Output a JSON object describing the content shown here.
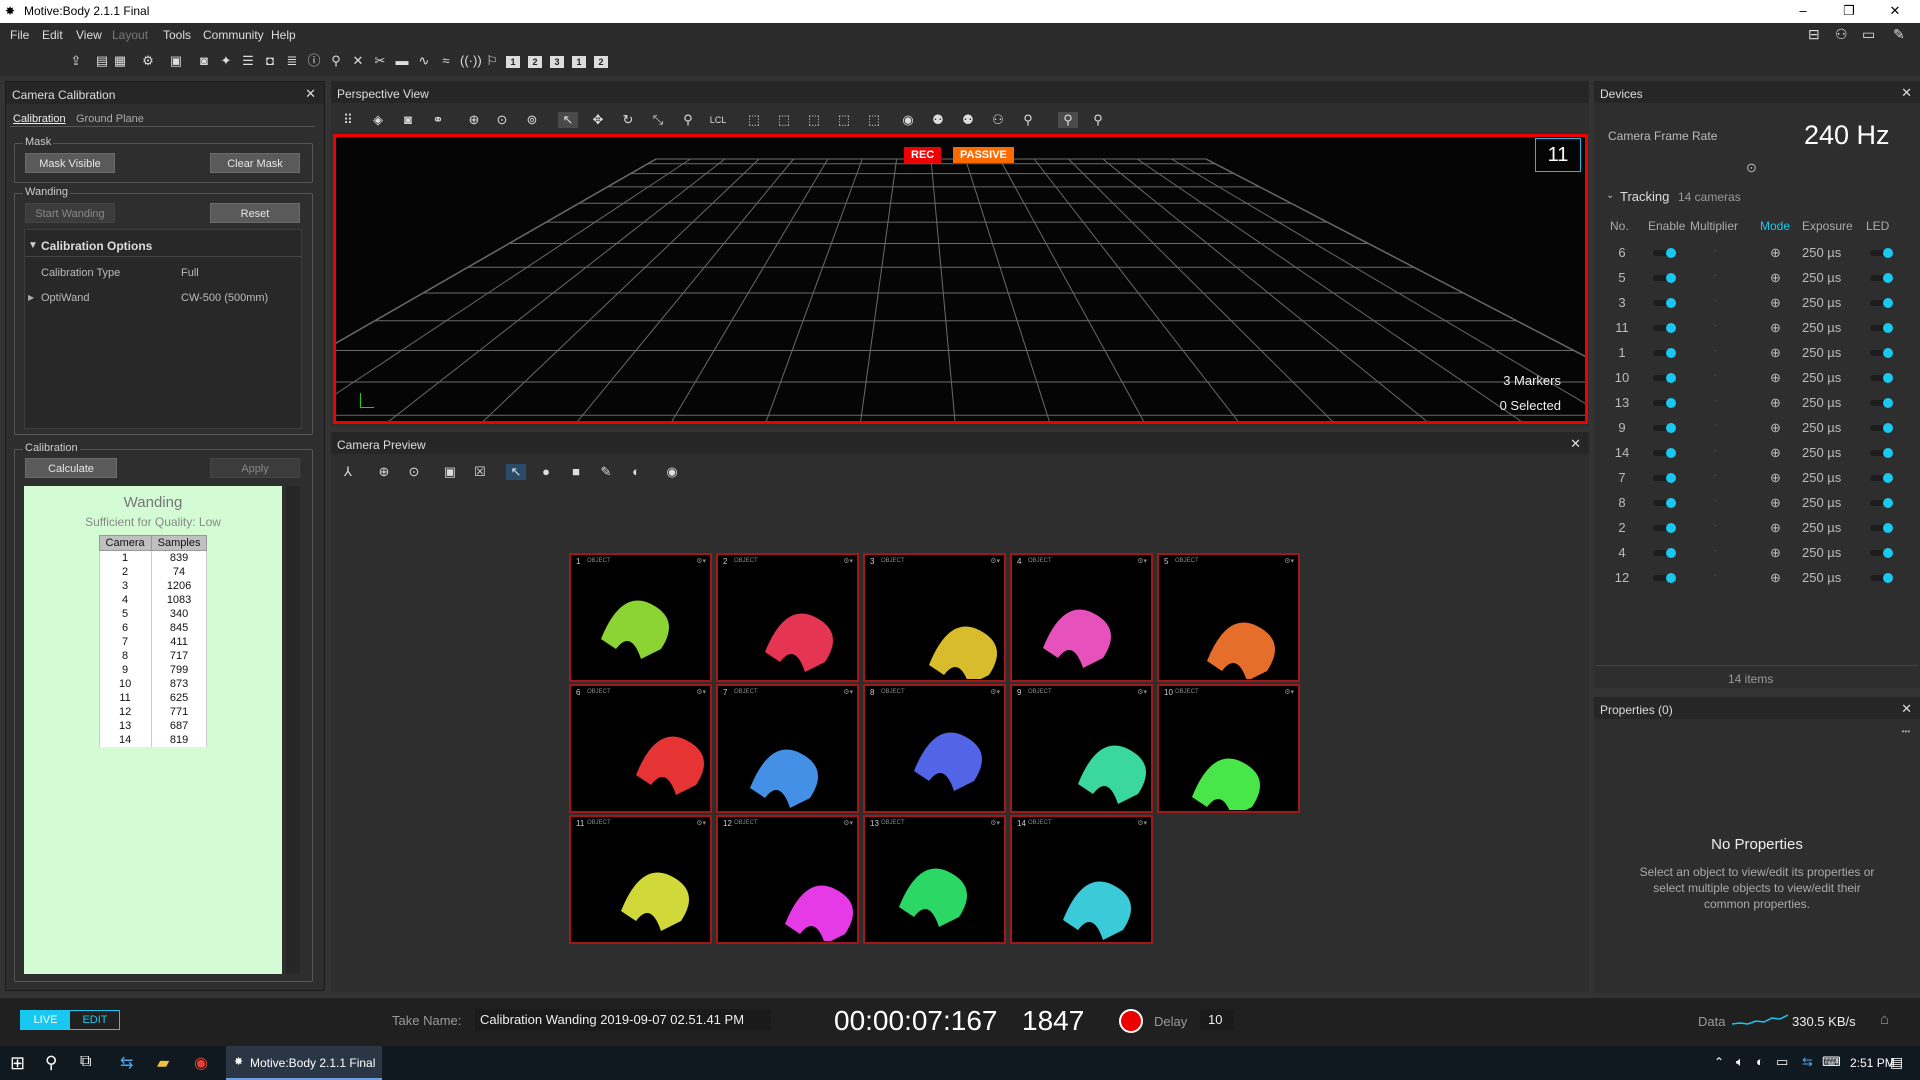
{
  "window": {
    "title": "Motive:Body 2.1.1 Final",
    "controls": [
      "–",
      "❐",
      "✕"
    ]
  },
  "menu": [
    "File",
    "Edit",
    "View",
    "Layout",
    "Tools",
    "Community",
    "Help"
  ],
  "toolbar": {
    "num_buttons": [
      "1",
      "2",
      "3",
      "1",
      "2"
    ]
  },
  "calib": {
    "title": "Camera Calibration",
    "tabs": [
      "Calibration",
      "Ground Plane"
    ],
    "mask": {
      "title": "Mask",
      "mask_visible": "Mask Visible",
      "clear_mask": "Clear Mask"
    },
    "wanding": {
      "title": "Wanding",
      "start": "Start Wanding",
      "reset": "Reset"
    },
    "options": {
      "title": "Calibration Options",
      "type_label": "Calibration Type",
      "type_value": "Full",
      "wand_label": "OptiWand",
      "wand_value": "CW-500 (500mm)"
    },
    "calibration": {
      "title": "Calibration",
      "calculate": "Calculate",
      "apply": "Apply"
    },
    "result": {
      "title": "Wanding",
      "quality": "Sufficient for Quality: Low",
      "col_camera": "Camera",
      "col_samples": "Samples",
      "rows": [
        [
          "1",
          "839"
        ],
        [
          "2",
          "74"
        ],
        [
          "3",
          "1206"
        ],
        [
          "4",
          "1083"
        ],
        [
          "5",
          "340"
        ],
        [
          "6",
          "845"
        ],
        [
          "7",
          "411"
        ],
        [
          "8",
          "717"
        ],
        [
          "9",
          "799"
        ],
        [
          "10",
          "873"
        ],
        [
          "11",
          "625"
        ],
        [
          "12",
          "771"
        ],
        [
          "13",
          "687"
        ],
        [
          "14",
          "819"
        ]
      ]
    }
  },
  "perspective": {
    "title": "Perspective View",
    "rec": "REC",
    "passive": "PASSIVE",
    "cube": "11",
    "markers": "3 Markers",
    "selected": "0 Selected",
    "tb_lcl": "LCL"
  },
  "preview": {
    "title": "Camera Preview",
    "tile_label": "OBJECT",
    "tiles": [
      {
        "n": "1",
        "color": "#9bea3a"
      },
      {
        "n": "2",
        "color": "#ff3b5c"
      },
      {
        "n": "3",
        "color": "#f0d030"
      },
      {
        "n": "4",
        "color": "#ff5ad0"
      },
      {
        "n": "5",
        "color": "#ff7a30"
      },
      {
        "n": "6",
        "color": "#ff3a3a"
      },
      {
        "n": "7",
        "color": "#4aa0ff"
      },
      {
        "n": "8",
        "color": "#5a70ff"
      },
      {
        "n": "9",
        "color": "#40f0b0"
      },
      {
        "n": "10",
        "color": "#50ff50"
      },
      {
        "n": "11",
        "color": "#e8f040"
      },
      {
        "n": "12",
        "color": "#ff40ff"
      },
      {
        "n": "13",
        "color": "#30f070"
      },
      {
        "n": "14",
        "color": "#40e0f0"
      }
    ]
  },
  "devices": {
    "title": "Devices",
    "frame_rate_label": "Camera Frame Rate",
    "frame_rate": "240 Hz",
    "tracking_label": "Tracking",
    "tracking_count": "14 cameras",
    "cols": [
      "No.",
      "Enable",
      "Multiplier",
      "Mode",
      "Exposure",
      "LED"
    ],
    "multiplier": "-",
    "cameras": [
      "6",
      "5",
      "3",
      "11",
      "1",
      "10",
      "13",
      "9",
      "14",
      "7",
      "8",
      "2",
      "4",
      "12"
    ],
    "exposure": "250 µs",
    "items": "14 items"
  },
  "properties": {
    "title": "Properties (0)",
    "no_props": "No Properties",
    "hint": "Select an object to view/edit its properties or select multiple objects to view/edit their common properties.",
    "more": "•••"
  },
  "status": {
    "live": "LIVE",
    "edit": "EDIT",
    "take_label": "Take Name:",
    "take_name": "Calibration Wanding 2019-09-07 02.51.41 PM",
    "timecode": "00:00:07:167",
    "frame": "1847",
    "delay_label": "Delay",
    "delay": "10",
    "data_label": "Data",
    "data_rate": "330.5 KB/s"
  },
  "taskbar": {
    "app": "Motive:Body 2.1.1 Final",
    "time": "2:51 PM"
  },
  "colors": {
    "accent": "#19c8f0",
    "rec": "#e00000",
    "passive": "#ff6a00",
    "wand_bg": "#d4fcd4"
  }
}
